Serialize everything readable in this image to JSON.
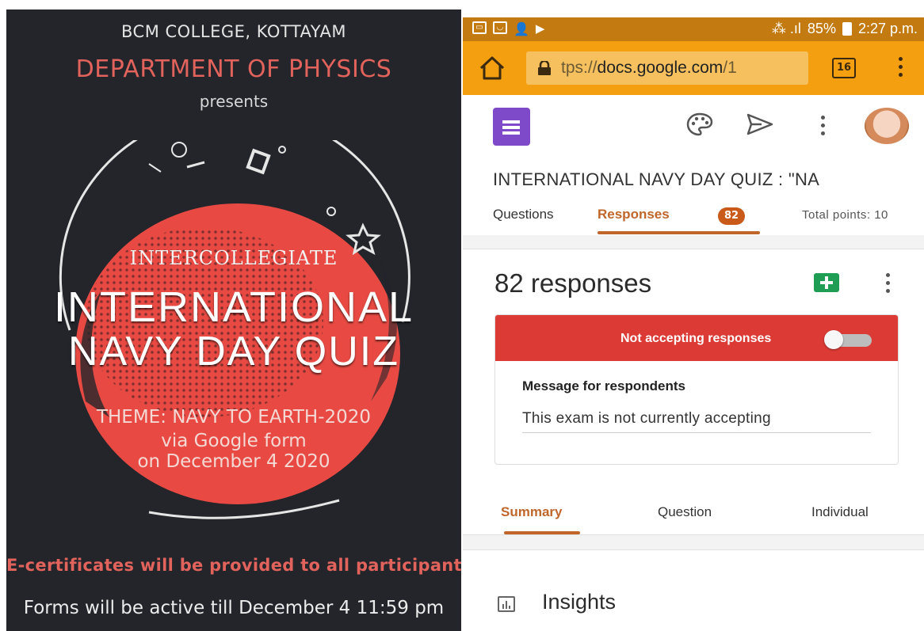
{
  "poster": {
    "college": "BCM COLLEGE, KOTTAYAM",
    "department": "DEPARTMENT OF PHYSICS",
    "presents": "presents",
    "intercollegiate": "INTERCOLLEGIATE",
    "title_line1": "INTERNATIONAL",
    "title_line2": "NAVY DAY QUIZ",
    "theme": "THEME: NAVY TO EARTH-2020",
    "via": "via Google form",
    "date": "on December 4 2020",
    "certificates": "E-certificates will be provided to all participants",
    "active_till": "Forms will be active till December 4  11:59 pm",
    "colors": {
      "background": "#23252b",
      "accent": "#e2625c",
      "splash": "#e84a43"
    }
  },
  "statusbar": {
    "left_icons": [
      "gallery-icon",
      "wifi-icon",
      "person-add-icon",
      "play-icon"
    ],
    "network": "⁂ .ıl",
    "battery": "85%",
    "time": "2:27 p.m."
  },
  "browser": {
    "url_prefix": "tps://",
    "url_domain": "docs.google.com",
    "url_suffix": "/1",
    "tab_count": "16",
    "colors": {
      "statusbar": "#c37a10",
      "toolbar": "#f39f10"
    }
  },
  "form": {
    "title": "INTERNATIONAL NAVY DAY QUIZ : \"NA",
    "tabs": [
      {
        "label": "Questions"
      },
      {
        "label": "Responses",
        "badge": "82"
      }
    ],
    "total_points": "Total points: 10",
    "response_count": "82 responses",
    "accepting_label": "Not accepting responses",
    "accepting": false,
    "message_label": "Message for respondents",
    "message_text": "This exam is not currently accepting",
    "summary_tabs": [
      "Summary",
      "Question",
      "Individual"
    ],
    "insights_label": "Insights",
    "colors": {
      "forms_purple": "#7e4ac9",
      "accent": "#c0662b",
      "closed_red": "#dc3a35",
      "sheets_green": "#1f9d55"
    }
  }
}
